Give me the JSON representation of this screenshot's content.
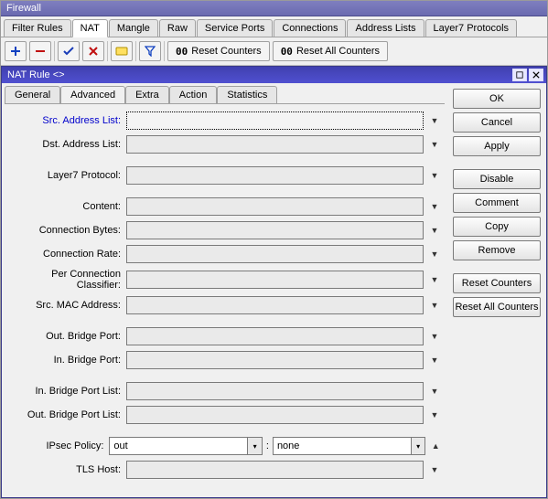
{
  "window": {
    "title": "Firewall"
  },
  "main_tabs": [
    {
      "label": "Filter Rules"
    },
    {
      "label": "NAT"
    },
    {
      "label": "Mangle"
    },
    {
      "label": "Raw"
    },
    {
      "label": "Service Ports"
    },
    {
      "label": "Connections"
    },
    {
      "label": "Address Lists"
    },
    {
      "label": "Layer7 Protocols"
    }
  ],
  "main_tabs_active_index": 1,
  "toolbar": {
    "add_icon": "plus-icon",
    "remove_icon": "minus-icon",
    "enable_icon": "check-icon",
    "disable_icon": "x-icon",
    "comment_icon": "note-icon",
    "filter_icon": "funnel-icon",
    "reset_prefix": "00",
    "reset_counters_label": "Reset Counters",
    "reset_all_counters_label": "Reset All Counters"
  },
  "dialog": {
    "title": "NAT Rule <>",
    "tabs": [
      {
        "label": "General"
      },
      {
        "label": "Advanced"
      },
      {
        "label": "Extra"
      },
      {
        "label": "Action"
      },
      {
        "label": "Statistics"
      }
    ],
    "tabs_active_index": 1
  },
  "form": {
    "src_address_list": {
      "label": "Src. Address List:",
      "value": ""
    },
    "dst_address_list": {
      "label": "Dst. Address List:",
      "value": ""
    },
    "layer7_protocol": {
      "label": "Layer7 Protocol:",
      "value": ""
    },
    "content": {
      "label": "Content:",
      "value": ""
    },
    "connection_bytes": {
      "label": "Connection Bytes:",
      "value": ""
    },
    "connection_rate": {
      "label": "Connection Rate:",
      "value": ""
    },
    "per_conn_class": {
      "label": "Per Connection Classifier:",
      "value": ""
    },
    "src_mac": {
      "label": "Src. MAC Address:",
      "value": ""
    },
    "out_bridge_port": {
      "label": "Out. Bridge Port:",
      "value": ""
    },
    "in_bridge_port": {
      "label": "In. Bridge Port:",
      "value": ""
    },
    "in_bridge_port_list": {
      "label": "In. Bridge Port List:",
      "value": ""
    },
    "out_bridge_port_list": {
      "label": "Out. Bridge Port List:",
      "value": ""
    },
    "ipsec_policy": {
      "label": "IPsec Policy:",
      "direction": "out",
      "colon": ":",
      "level": "none"
    },
    "tls_host": {
      "label": "TLS Host:",
      "value": ""
    }
  },
  "side_buttons": {
    "ok": "OK",
    "cancel": "Cancel",
    "apply": "Apply",
    "disable": "Disable",
    "comment": "Comment",
    "copy": "Copy",
    "remove": "Remove",
    "reset_counters": "Reset Counters",
    "reset_all_counters": "Reset All Counters"
  }
}
